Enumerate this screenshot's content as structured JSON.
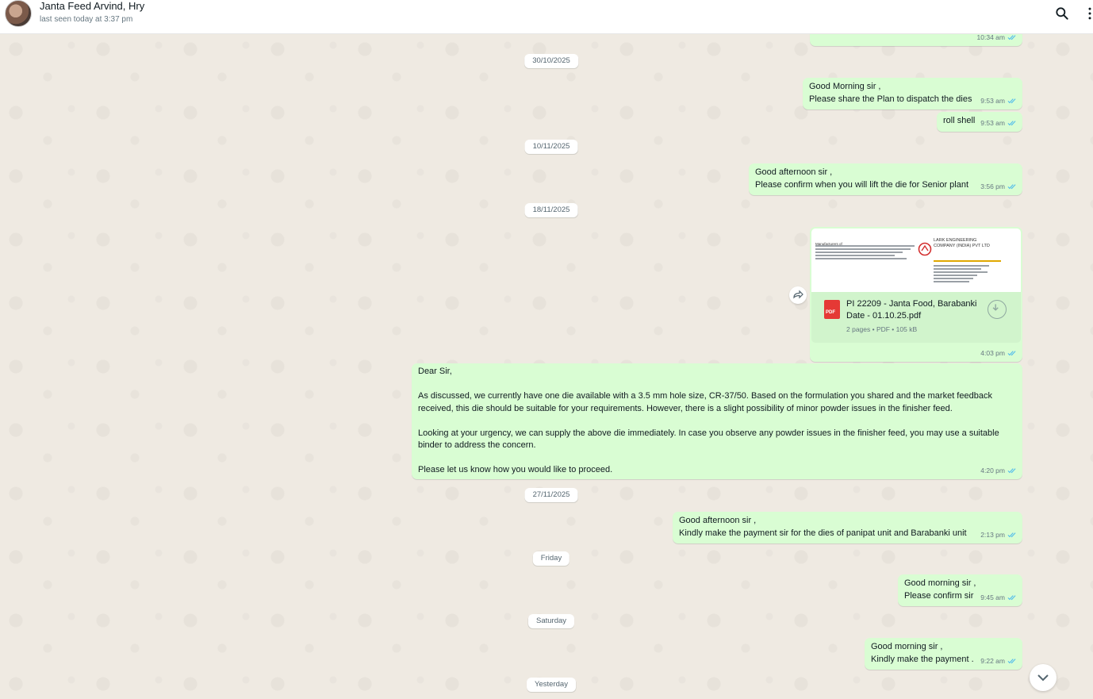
{
  "header": {
    "contact_name": "Janta Feed Arvind, Hry",
    "last_seen": "last seen today at 3:37 pm"
  },
  "messages": {
    "m0": {
      "time": "10:34 am"
    },
    "d1": "30/10/2025",
    "m1": {
      "text": "Good Morning sir ,\nPlease share the Plan to dispatch the dies",
      "time": "9:53 am"
    },
    "m2": {
      "text": "roll shell",
      "time": "9:53 am"
    },
    "d2": "10/11/2025",
    "m3": {
      "text": "Good afternoon sir ,\nPlease confirm when you will lift the die for Senior plant",
      "time": "3:56 pm"
    },
    "d3": "18/11/2025",
    "doc": {
      "preview_company": "LARK ENGINEERING COMPANY (INDIA) PVT LTD",
      "preview_heading": "Manufacturers of",
      "file_name": "PI 22209 - Janta Food, Barabanki Date - 01.10.25.pdf",
      "file_meta": "2 pages • PDF • 105 kB",
      "pdf_label": "PDF",
      "time": "4:03 pm"
    },
    "m4": {
      "text": "Dear Sir,\n\nAs discussed, we currently have one die available with a 3.5 mm hole size, CR-37/50. Based on the formulation you shared and the market feedback received, this die should be suitable for your requirements. However, there is a slight possibility of minor powder issues in the finisher feed.\n\nLooking at your urgency, we can supply the above die immediately. In case you observe any powder issues in the finisher feed, you may use a suitable binder to address the concern.\n\nPlease let us know how you would like to proceed.",
      "time": "4:20 pm"
    },
    "d4": "27/11/2025",
    "m5": {
      "text": "Good afternoon sir ,\nKindly make the payment sir for the dies of panipat unit and Barabanki unit",
      "time": "2:13 pm"
    },
    "d5": "Friday",
    "m6": {
      "text": "Good morning sir ,\nPlease confirm sir",
      "time": "9:45 am"
    },
    "d6": "Saturday",
    "m7": {
      "text": "Good morning sir ,\nKindly make the payment .",
      "time": "9:22 am"
    },
    "d7": "Yesterday"
  },
  "colors": {
    "bubble_out": "#d9fdd3",
    "chat_bg": "#efeae2",
    "read_ticks": "#53bdeb"
  }
}
